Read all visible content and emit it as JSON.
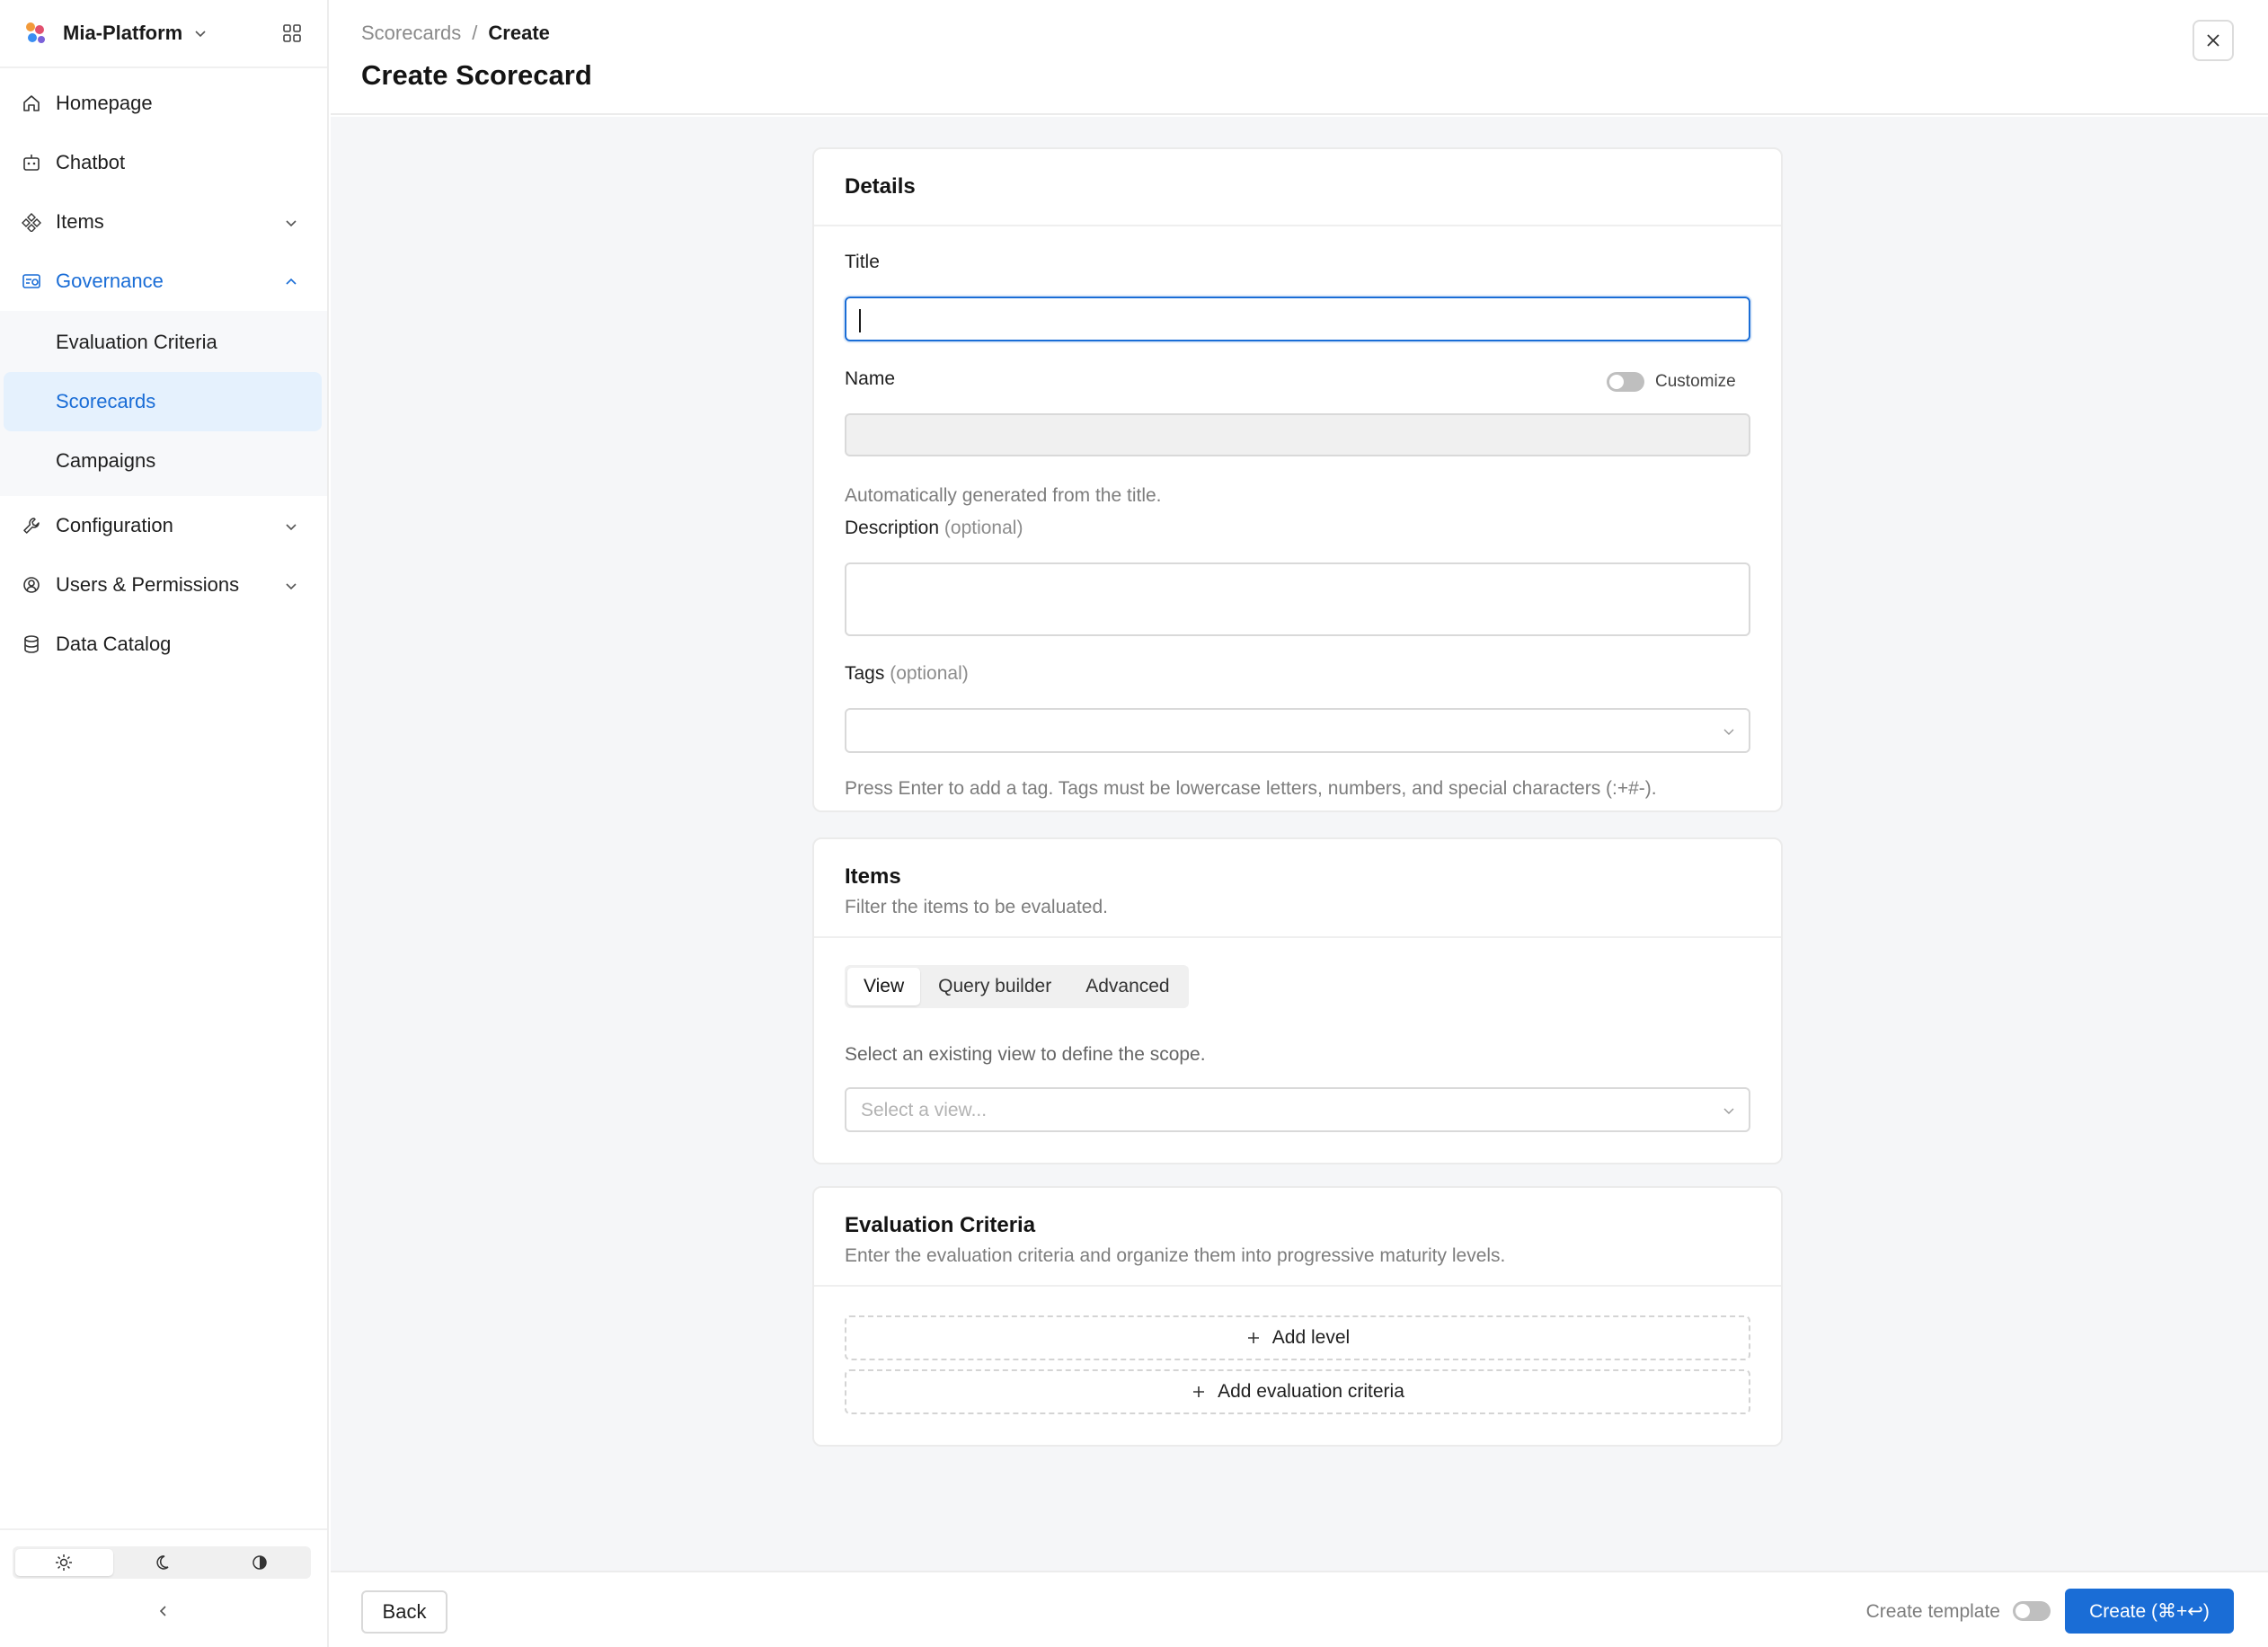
{
  "sidebar": {
    "brand": "Mia-Platform",
    "nav": {
      "homepage": "Homepage",
      "chatbot": "Chatbot",
      "items": "Items",
      "governance": "Governance",
      "evaluation_criteria": "Evaluation Criteria",
      "scorecards": "Scorecards",
      "campaigns": "Campaigns",
      "configuration": "Configuration",
      "users_permissions": "Users & Permissions",
      "data_catalog": "Data Catalog"
    },
    "theme_selected": "light"
  },
  "header": {
    "breadcrumb": {
      "parent": "Scorecards",
      "separator": "/",
      "current": "Create"
    },
    "title": "Create Scorecard"
  },
  "details": {
    "title": "Details",
    "title_label": "Title",
    "title_value": "",
    "name_label": "Name",
    "customize_label": "Customize",
    "name_value": "",
    "name_help": "Automatically generated from the title.",
    "description_label": "Description",
    "optional": "(optional)",
    "description_value": "",
    "tags_label": "Tags",
    "tags_help": "Press Enter to add a tag. Tags must be lowercase letters, numbers, and special characters (:+#-)."
  },
  "items": {
    "title": "Items",
    "subtitle": "Filter the items to be evaluated.",
    "tabs": [
      "View",
      "Query builder",
      "Advanced"
    ],
    "active_tab": "View",
    "scope_help": "Select an existing view to define the scope.",
    "view_placeholder": "Select a view..."
  },
  "criteria": {
    "title": "Evaluation Criteria",
    "subtitle": "Enter the evaluation criteria and organize them into progressive maturity levels.",
    "add_level": "Add level",
    "add_criteria": "Add evaluation criteria"
  },
  "footer": {
    "back": "Back",
    "create_template": "Create template",
    "create": "Create (⌘+↩)"
  },
  "colors": {
    "accent": "#1a6dd6",
    "active_bg": "#e5f1fd",
    "content_bg": "#f5f6f8"
  }
}
